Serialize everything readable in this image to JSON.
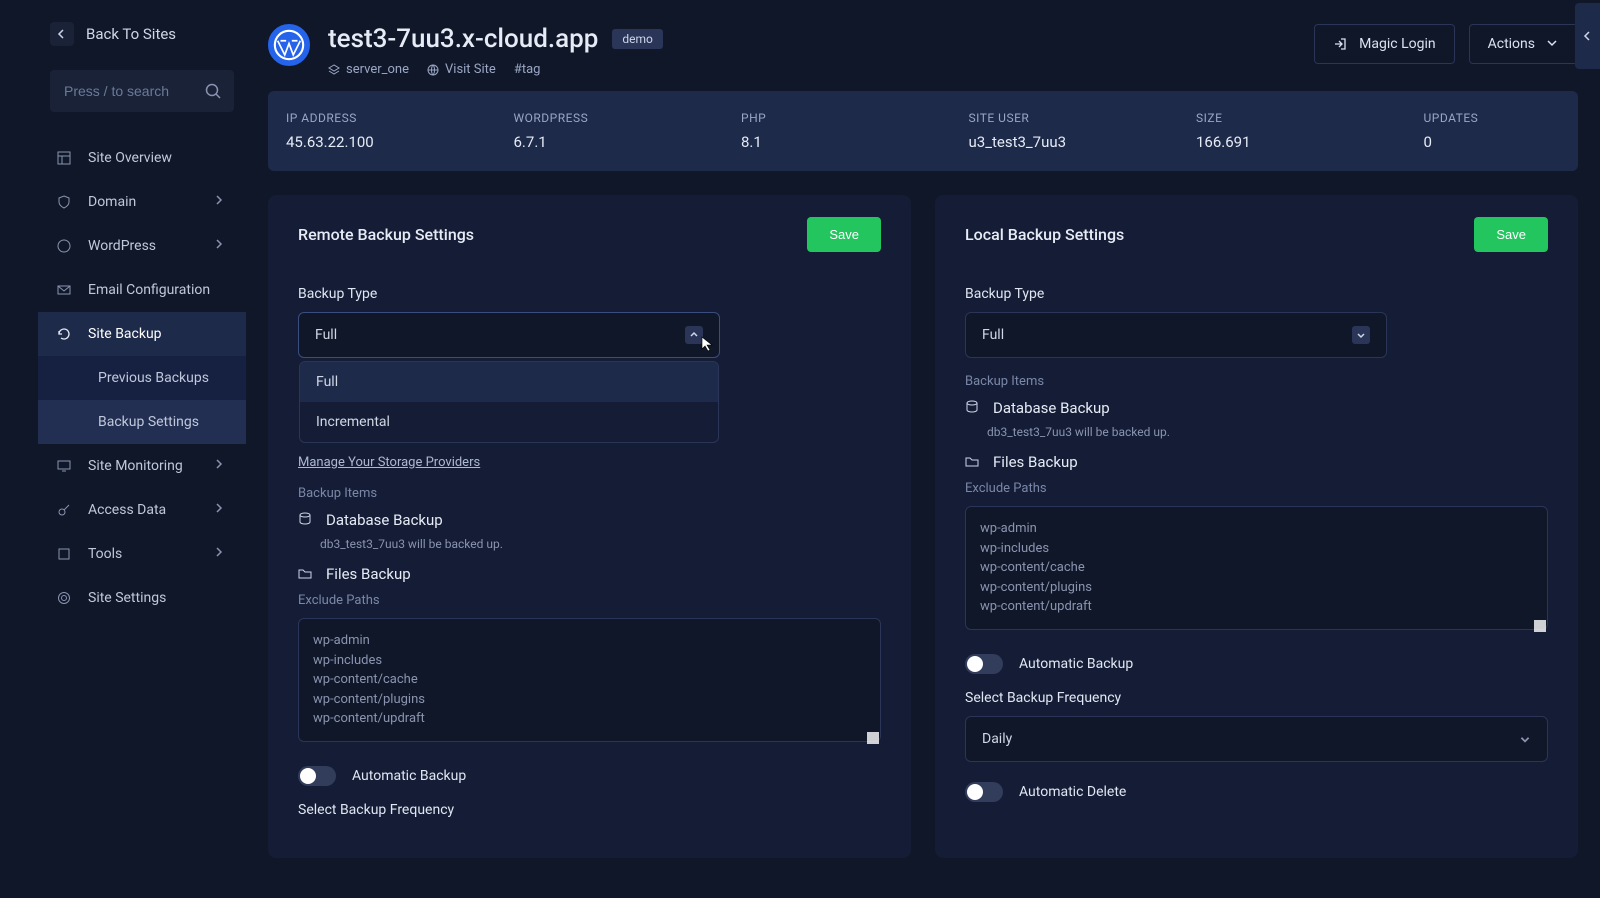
{
  "back_label": "Back To Sites",
  "search_placeholder": "Press / to search",
  "nav": {
    "overview": "Site Overview",
    "domain": "Domain",
    "wordpress": "WordPress",
    "email": "Email Configuration",
    "backup": "Site Backup",
    "prev_backups": "Previous Backups",
    "backup_settings": "Backup Settings",
    "monitoring": "Site Monitoring",
    "access": "Access Data",
    "tools": "Tools",
    "settings": "Site Settings"
  },
  "header": {
    "title": "test3-7uu3.x-cloud.app",
    "badge": "demo",
    "server": "server_one",
    "visit": "Visit Site",
    "tag": "#tag",
    "magic": "Magic Login",
    "actions": "Actions"
  },
  "info": {
    "ip_label": "IP ADDRESS",
    "ip": "45.63.22.100",
    "wp_label": "WORDPRESS",
    "wp": "6.7.1",
    "php_label": "PHP",
    "php": "8.1",
    "user_label": "SITE USER",
    "user": "u3_test3_7uu3",
    "size_label": "SIZE",
    "size": "166.691",
    "updates_label": "UPDATES",
    "updates": "0"
  },
  "remote": {
    "title": "Remote Backup Settings",
    "save": "Save",
    "type_label": "Backup Type",
    "type_value": "Full",
    "opt_full": "Full",
    "opt_incremental": "Incremental",
    "manage": "Manage Your Storage Providers",
    "items_label": "Backup Items",
    "db_title": "Database Backup",
    "db_desc": "db3_test3_7uu3 will be backed up.",
    "files_title": "Files Backup",
    "exclude_label": "Exclude Paths",
    "exclude_text": "wp-admin\nwp-includes\nwp-content/cache\nwp-content/plugins\nwp-content/updraft",
    "auto_label": "Automatic Backup",
    "freq_label": "Select Backup Frequency"
  },
  "local": {
    "title": "Local Backup Settings",
    "save": "Save",
    "type_label": "Backup Type",
    "type_value": "Full",
    "items_label": "Backup Items",
    "db_title": "Database Backup",
    "db_desc": "db3_test3_7uu3 will be backed up.",
    "files_title": "Files Backup",
    "exclude_label": "Exclude Paths",
    "exclude_text": "wp-admin\nwp-includes\nwp-content/cache\nwp-content/plugins\nwp-content/updraft",
    "auto_label": "Automatic Backup",
    "freq_label": "Select Backup Frequency",
    "freq_value": "Daily",
    "delete_label": "Automatic Delete"
  }
}
